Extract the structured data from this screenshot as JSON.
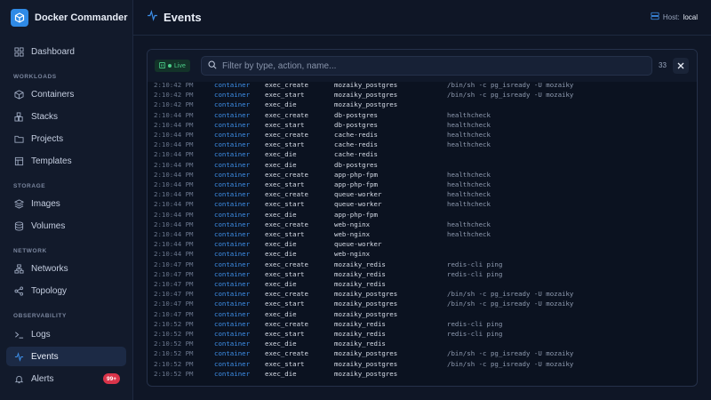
{
  "brand": {
    "title": "Docker Commander"
  },
  "nav": {
    "dashboard": "Dashboard",
    "sections": {
      "workloads": "WORKLOADS",
      "storage": "STORAGE",
      "network": "NETWORK",
      "observability": "OBSERVABILITY"
    },
    "items": {
      "containers": "Containers",
      "stacks": "Stacks",
      "projects": "Projects",
      "templates": "Templates",
      "images": "Images",
      "volumes": "Volumes",
      "networks": "Networks",
      "topology": "Topology",
      "logs": "Logs",
      "events": "Events",
      "alerts": "Alerts"
    },
    "alerts_badge": "99+"
  },
  "header": {
    "title": "Events",
    "host_label": "Host:",
    "host_value": "local"
  },
  "toolbar": {
    "live_label": "Live",
    "search_placeholder": "Filter by type, action, name...",
    "count": "33"
  },
  "colors": {
    "accent": "#3d8ee8",
    "live": "#4ccf8a",
    "badge": "#d9344a"
  },
  "events": [
    {
      "time": "2:10:42 PM",
      "type": "container",
      "action": "exec_create",
      "name": "mozaiky_postgres",
      "detail": "/bin/sh -c pg_isready -U mozaiky"
    },
    {
      "time": "2:10:42 PM",
      "type": "container",
      "action": "exec_start",
      "name": "mozaiky_postgres",
      "detail": "/bin/sh -c pg_isready -U mozaiky"
    },
    {
      "time": "2:10:42 PM",
      "type": "container",
      "action": "exec_die",
      "name": "mozaiky_postgres",
      "detail": ""
    },
    {
      "time": "2:10:44 PM",
      "type": "container",
      "action": "exec_create",
      "name": "db-postgres",
      "detail": "healthcheck"
    },
    {
      "time": "2:10:44 PM",
      "type": "container",
      "action": "exec_start",
      "name": "db-postgres",
      "detail": "healthcheck"
    },
    {
      "time": "2:10:44 PM",
      "type": "container",
      "action": "exec_create",
      "name": "cache-redis",
      "detail": "healthcheck"
    },
    {
      "time": "2:10:44 PM",
      "type": "container",
      "action": "exec_start",
      "name": "cache-redis",
      "detail": "healthcheck"
    },
    {
      "time": "2:10:44 PM",
      "type": "container",
      "action": "exec_die",
      "name": "cache-redis",
      "detail": ""
    },
    {
      "time": "2:10:44 PM",
      "type": "container",
      "action": "exec_die",
      "name": "db-postgres",
      "detail": ""
    },
    {
      "time": "2:10:44 PM",
      "type": "container",
      "action": "exec_create",
      "name": "app-php-fpm",
      "detail": "healthcheck"
    },
    {
      "time": "2:10:44 PM",
      "type": "container",
      "action": "exec_start",
      "name": "app-php-fpm",
      "detail": "healthcheck"
    },
    {
      "time": "2:10:44 PM",
      "type": "container",
      "action": "exec_create",
      "name": "queue-worker",
      "detail": "healthcheck"
    },
    {
      "time": "2:10:44 PM",
      "type": "container",
      "action": "exec_start",
      "name": "queue-worker",
      "detail": "healthcheck"
    },
    {
      "time": "2:10:44 PM",
      "type": "container",
      "action": "exec_die",
      "name": "app-php-fpm",
      "detail": ""
    },
    {
      "time": "2:10:44 PM",
      "type": "container",
      "action": "exec_create",
      "name": "web-nginx",
      "detail": "healthcheck"
    },
    {
      "time": "2:10:44 PM",
      "type": "container",
      "action": "exec_start",
      "name": "web-nginx",
      "detail": "healthcheck"
    },
    {
      "time": "2:10:44 PM",
      "type": "container",
      "action": "exec_die",
      "name": "queue-worker",
      "detail": ""
    },
    {
      "time": "2:10:44 PM",
      "type": "container",
      "action": "exec_die",
      "name": "web-nginx",
      "detail": ""
    },
    {
      "time": "2:10:47 PM",
      "type": "container",
      "action": "exec_create",
      "name": "mozaiky_redis",
      "detail": "redis-cli ping"
    },
    {
      "time": "2:10:47 PM",
      "type": "container",
      "action": "exec_start",
      "name": "mozaiky_redis",
      "detail": "redis-cli ping"
    },
    {
      "time": "2:10:47 PM",
      "type": "container",
      "action": "exec_die",
      "name": "mozaiky_redis",
      "detail": ""
    },
    {
      "time": "2:10:47 PM",
      "type": "container",
      "action": "exec_create",
      "name": "mozaiky_postgres",
      "detail": "/bin/sh -c pg_isready -U mozaiky"
    },
    {
      "time": "2:10:47 PM",
      "type": "container",
      "action": "exec_start",
      "name": "mozaiky_postgres",
      "detail": "/bin/sh -c pg_isready -U mozaiky"
    },
    {
      "time": "2:10:47 PM",
      "type": "container",
      "action": "exec_die",
      "name": "mozaiky_postgres",
      "detail": ""
    },
    {
      "time": "2:10:52 PM",
      "type": "container",
      "action": "exec_create",
      "name": "mozaiky_redis",
      "detail": "redis-cli ping"
    },
    {
      "time": "2:10:52 PM",
      "type": "container",
      "action": "exec_start",
      "name": "mozaiky_redis",
      "detail": "redis-cli ping"
    },
    {
      "time": "2:10:52 PM",
      "type": "container",
      "action": "exec_die",
      "name": "mozaiky_redis",
      "detail": ""
    },
    {
      "time": "2:10:52 PM",
      "type": "container",
      "action": "exec_create",
      "name": "mozaiky_postgres",
      "detail": "/bin/sh -c pg_isready -U mozaiky"
    },
    {
      "time": "2:10:52 PM",
      "type": "container",
      "action": "exec_start",
      "name": "mozaiky_postgres",
      "detail": "/bin/sh -c pg_isready -U mozaiky"
    },
    {
      "time": "2:10:52 PM",
      "type": "container",
      "action": "exec_die",
      "name": "mozaiky_postgres",
      "detail": ""
    }
  ]
}
